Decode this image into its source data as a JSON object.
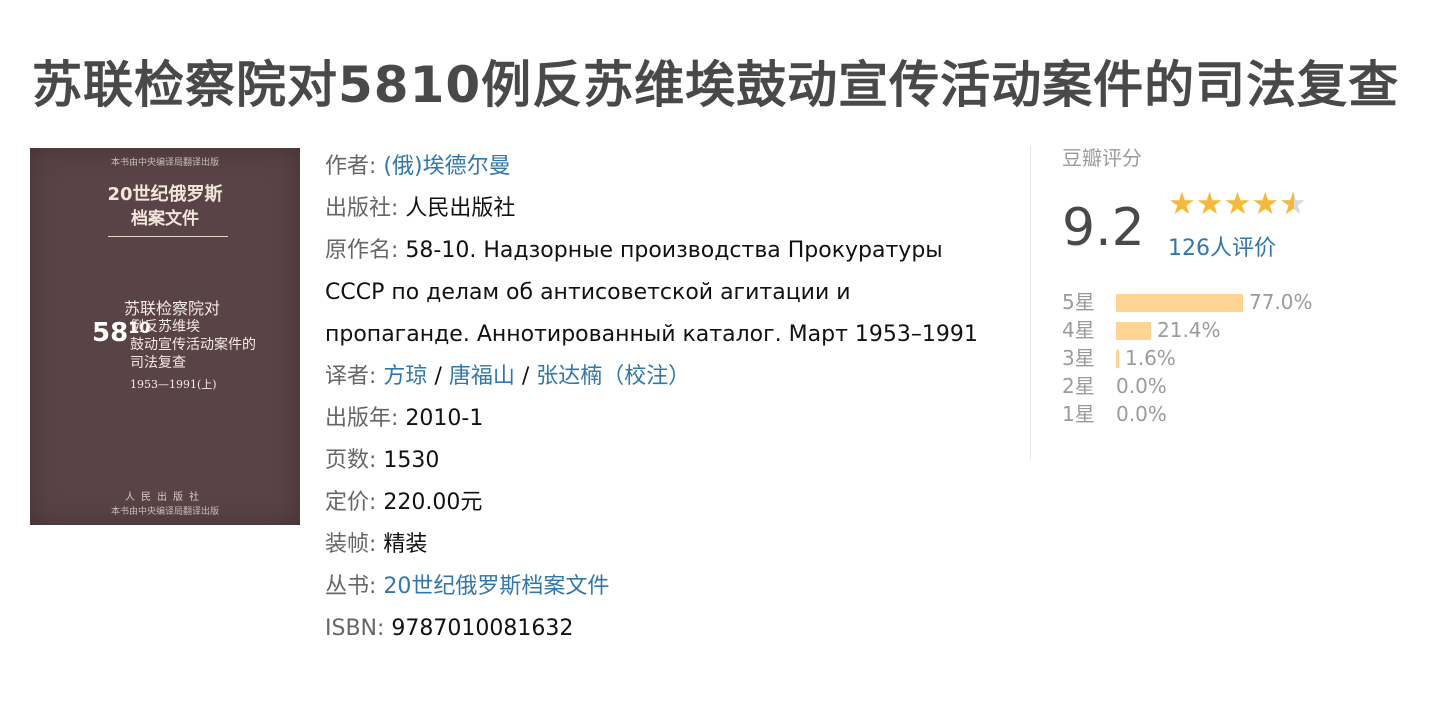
{
  "title": "苏联检察院对5810例反苏维埃鼓动宣传活动案件的司法复查",
  "cover": {
    "top_note": "本书由中央编译局翻译出版",
    "series_line1": "20世纪俄罗斯",
    "series_line2": "档案文件",
    "main_line1": "苏联检察院对",
    "num_main": "58",
    "num_sup": "10",
    "main_line2": "例反苏维埃",
    "main_line3": "鼓动宣传活动案件的",
    "main_line4": "司法复查",
    "years": "1953—1991(上)",
    "publisher_logo": "人民出版社",
    "bottom_note": "本书由中央编译局翻译出版"
  },
  "info": {
    "author_label": "作者:",
    "author": "(俄)埃德尔曼",
    "publisher_label": "出版社:",
    "publisher": "人民出版社",
    "original_title_label": "原作名:",
    "original_title": "58-10. Надзорные производства Прокуратуры СССР по делам об антисоветской агитации и пропаганде. Аннотированный каталог. Март 1953–1991",
    "translator_label": "译者:",
    "translators": [
      "方琼",
      "唐福山",
      "张达楠（校注）"
    ],
    "sep": "/",
    "pubdate_label": "出版年:",
    "pubdate": "2010-1",
    "pages_label": "页数:",
    "pages": "1530",
    "price_label": "定价:",
    "price": "220.00元",
    "binding_label": "装帧:",
    "binding": "精装",
    "series_label": "丛书:",
    "series": "20世纪俄罗斯档案文件",
    "isbn_label": "ISBN:",
    "isbn": "9787010081632"
  },
  "rating": {
    "header": "豆瓣评分",
    "score": "9.2",
    "stars_value": 4.5,
    "count": "126人评价",
    "distribution": [
      {
        "label": "5星",
        "pct": "77.0%",
        "value": 77.0
      },
      {
        "label": "4星",
        "pct": "21.4%",
        "value": 21.4
      },
      {
        "label": "3星",
        "pct": "1.6%",
        "value": 1.6
      },
      {
        "label": "2星",
        "pct": "0.0%",
        "value": 0.0
      },
      {
        "label": "1星",
        "pct": "0.0%",
        "value": 0.0
      }
    ],
    "colors": {
      "star": "#f4b93b",
      "bar": "#ffd596",
      "link": "#3377aa"
    }
  }
}
